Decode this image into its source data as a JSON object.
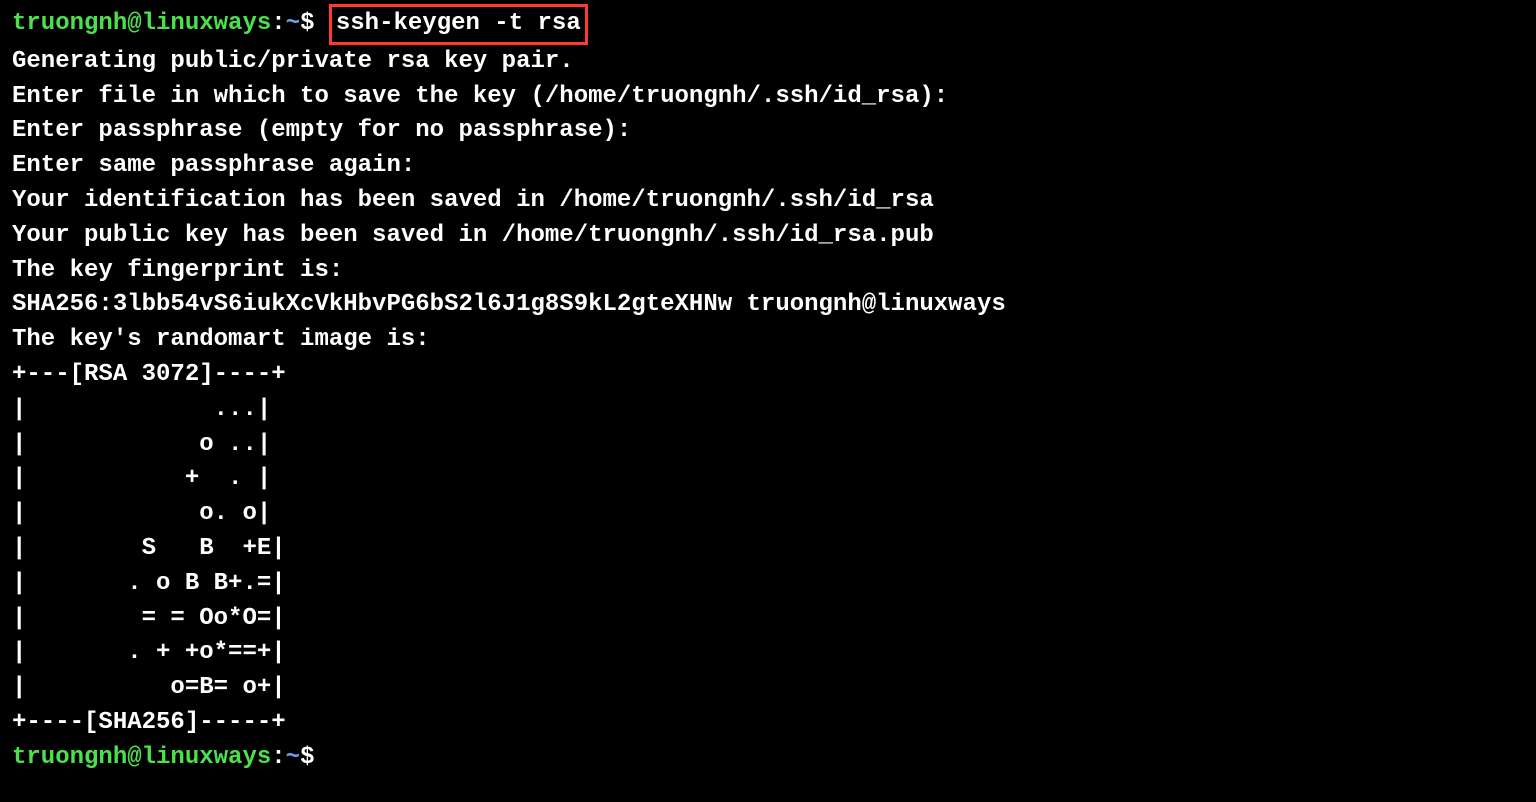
{
  "prompt1": {
    "user": "truongnh",
    "at": "@",
    "host": "linuxways",
    "colon": ":",
    "path": "~",
    "dollar": "$",
    "command": "ssh-keygen -t rsa"
  },
  "output": {
    "line1": "Generating public/private rsa key pair.",
    "line2": "Enter file in which to save the key (/home/truongnh/.ssh/id_rsa):",
    "line3": "Enter passphrase (empty for no passphrase):",
    "line4": "Enter same passphrase again:",
    "line5": "Your identification has been saved in /home/truongnh/.ssh/id_rsa",
    "line6": "Your public key has been saved in /home/truongnh/.ssh/id_rsa.pub",
    "line7": "The key fingerprint is:",
    "line8": "SHA256:3lbb54vS6iukXcVkHbvPG6bS2l6J1g8S9kL2gteXHNw truongnh@linuxways",
    "line9": "The key's randomart image is:",
    "art1": "+---[RSA 3072]----+",
    "art2": "|             ...|",
    "art3": "|            o ..|",
    "art4": "|           +  . |",
    "art5": "|            o. o|",
    "art6": "|        S   B  +E|",
    "art7": "|       . o B B+.=|",
    "art8": "|        = = Oo*O=|",
    "art9": "|       . + +o*==+|",
    "art10": "|          o=B= o+|",
    "art11": "+----[SHA256]-----+"
  },
  "prompt2": {
    "user": "truongnh",
    "at": "@",
    "host": "linuxways",
    "colon": ":",
    "path": "~",
    "dollar": "$"
  }
}
